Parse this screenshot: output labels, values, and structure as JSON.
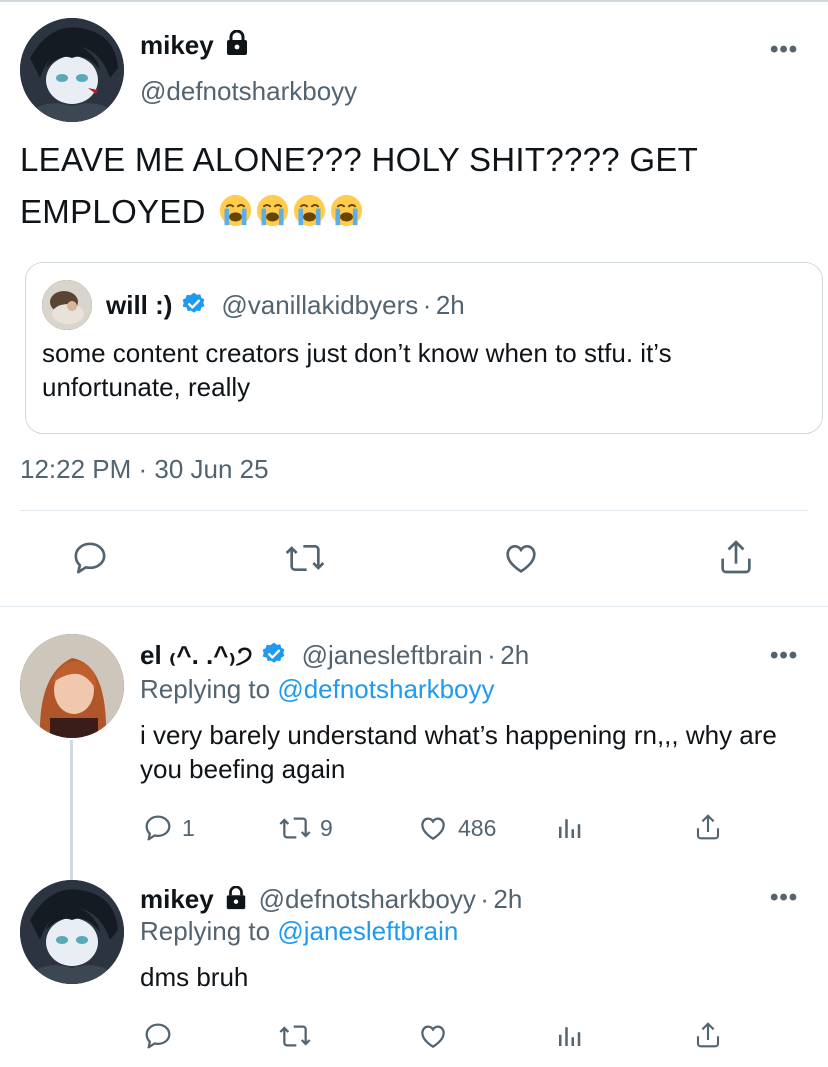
{
  "main_tweet": {
    "name": "mikey",
    "handle": "@defnotsharkboyy",
    "text": "LEAVE ME ALONE??? HOLY SHIT???? GET EMPLOYED",
    "emoji_icon": "loudly-crying-face-icon",
    "emoji_count": 4,
    "timestamp": "12:22 PM · 30 Jun 25"
  },
  "quoted_tweet": {
    "name": "will :)",
    "handle": "@vanillakidbyers",
    "separator": "·",
    "time": "2h",
    "text": "some content creators just don’t know when to stfu. it’s unfortunate, really"
  },
  "replies": [
    {
      "name": "el ₍^. .^₎੭",
      "verified": true,
      "handle": "@janesleftbrain",
      "separator": "·",
      "time": "2h",
      "replying_prefix": "Replying to",
      "replying_to": "@defnotsharkboyy",
      "text": "i very barely understand what’s happening rn,,, why are you beefing again",
      "reply_count": "1",
      "retweet_count": "9",
      "like_count": "486"
    },
    {
      "name": "mikey",
      "locked": true,
      "handle": "@defnotsharkboyy",
      "separator": "·",
      "time": "2h",
      "replying_prefix": "Replying to",
      "replying_to": "@janesleftbrain",
      "text": "dms bruh"
    }
  ],
  "colors": {
    "link": "#1d9bf0",
    "secondary": "#536471",
    "verified": "#1d9bf0",
    "border": "#cfd9de"
  }
}
